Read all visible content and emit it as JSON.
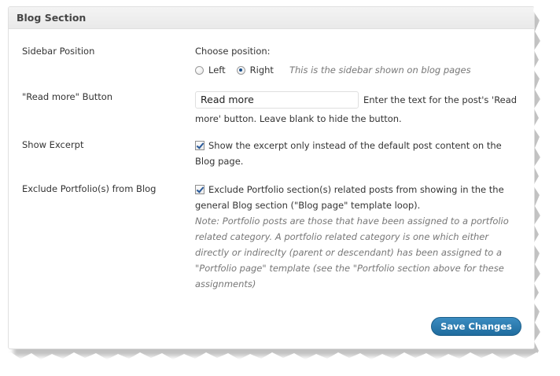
{
  "section": {
    "title": "Blog Section"
  },
  "rows": {
    "sidebar": {
      "label": "Sidebar Position",
      "prompt": "Choose position:",
      "options": [
        "Left",
        "Right"
      ],
      "selected": "Right",
      "description": "This is the sidebar shown on blog pages"
    },
    "read_more": {
      "label": "\"Read more\" Button",
      "value": "Read more",
      "description_line1": "Enter the text for the post's 'Read",
      "description_line2": "more' button. Leave blank to hide the button."
    },
    "excerpt": {
      "label": "Show Excerpt",
      "checked": true,
      "text_line1": "Show the excerpt only instead of the default post content on the",
      "text_line2": "Blog page."
    },
    "exclude_portfolio": {
      "label": "Exclude Portfolio(s) from Blog",
      "checked": true,
      "text_line1": "Exclude Portfolio section(s) related posts from showing in the the",
      "text_line2": "general Blog section (\"Blog page\" template loop).",
      "note_lines": [
        "Note: Portfolio posts are those that have been assigned to a portfolio",
        "related category. A portfolio related category is one which either",
        "directly or indirecIty (parent or descendant) has been assigned to a",
        "\"Portfolio page\" template (see the \"Portfolio section above for these",
        "assignments)"
      ]
    }
  },
  "actions": {
    "save_label": "Save Changes"
  },
  "colors": {
    "accent": "#21759b",
    "header_bg": "#ececec",
    "note_text": "#777777"
  }
}
